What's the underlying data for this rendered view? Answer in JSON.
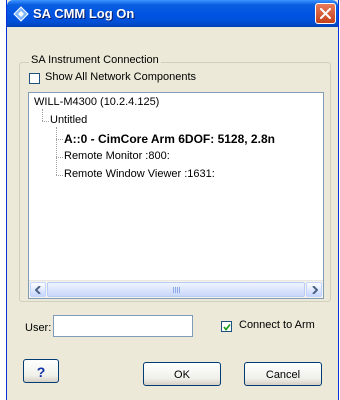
{
  "window": {
    "title": "SA CMM Log On",
    "icons": {
      "app": "sa-diamond-icon",
      "close": "close-icon"
    }
  },
  "instrument_connection": {
    "group_title": "SA Instrument Connection",
    "show_all_label": "Show All Network Components",
    "show_all_checked": false,
    "tree": [
      {
        "label": "WILL-M4300 (10.2.4.125)",
        "level": 0
      },
      {
        "label": "Untitled",
        "level": 1
      },
      {
        "label": "A::0 - CimCore Arm 6DOF: 5128, 2.8n",
        "level": 2,
        "selected": true
      },
      {
        "label": "Remote Monitor :800:",
        "level": 2
      },
      {
        "label": "Remote Window Viewer :1631:",
        "level": 2
      }
    ]
  },
  "user": {
    "label": "User:",
    "value": "",
    "placeholder": ""
  },
  "connect_to_arm": {
    "label": "Connect to Arm",
    "checked": true
  },
  "buttons": {
    "help": "?",
    "ok": "OK",
    "cancel": "Cancel"
  },
  "colors": {
    "titlebar": "#0054e3",
    "dialog_bg": "#ece9d8",
    "close_button": "#d9582f"
  }
}
